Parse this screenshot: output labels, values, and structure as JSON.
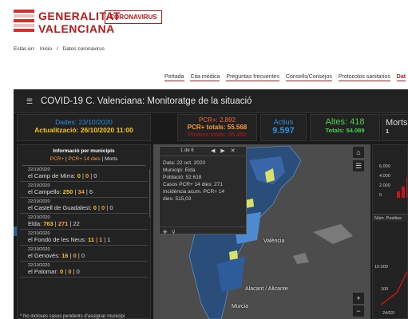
{
  "header": {
    "logo_line1": "GENERALITAT",
    "logo_line2": "VALENCIANA",
    "corona_label": "CORONAVIRUS"
  },
  "breadcrumb": {
    "prefix": "Estàs en:",
    "home": "Inicio",
    "separator": "/",
    "current": "Datos coronavirus"
  },
  "topnav": {
    "items": [
      "Portada",
      "Cita médica",
      "Preguntas frecuentes",
      "Consells/Consejos",
      "Protocolos sanitarios",
      "Dat"
    ]
  },
  "dashboard": {
    "title": "COVID-19 C. Valenciana: Monitoratge de la situació",
    "dates": {
      "line1": "Dades: 23/10/2020",
      "line2": "Actualització: 26/10/2020 11:00"
    },
    "pcr": {
      "line1": "PCR+: 2.892",
      "line2": "PCR+ totals: 55.568",
      "line3": "Positius totals: 65.450"
    },
    "actius": {
      "label": "Actius",
      "value": "9.597"
    },
    "altes": {
      "label": "Altes: 418",
      "total": "Totals: 54.089"
    },
    "morts": {
      "label": "Morts:",
      "value": "1"
    }
  },
  "list": {
    "title": "Informació per municipis",
    "legend_pcr": "PCR+",
    "legend_pcr14": "PCR+ 14 dies",
    "legend_morts": "Morts",
    "items": [
      {
        "date": "22/10/2020",
        "name": "el Camp de Mirra:",
        "a": "0",
        "b": "0",
        "c": "0"
      },
      {
        "date": "22/10/2020",
        "name": "el Campello:",
        "a": "250",
        "b": "34",
        "c": "6"
      },
      {
        "date": "22/10/2020",
        "name": "el Castell de Guadalest:",
        "a": "0",
        "b": "0",
        "c": "0"
      },
      {
        "date": "22/10/2020",
        "name": "Elda:",
        "a": "763",
        "b": "271",
        "c": "22"
      },
      {
        "date": "22/10/2020",
        "name": "el Fondó de les Neus:",
        "a": "11",
        "b": "1",
        "c": "1"
      },
      {
        "date": "22/10/2020",
        "name": "el Genovés:",
        "a": "16",
        "b": "0",
        "c": "0"
      },
      {
        "date": "22/10/2020",
        "name": "el Palomar:",
        "a": "0",
        "b": "0",
        "c": "0"
      }
    ],
    "footer": "* No incloses casos pendents d'assignar municipi"
  },
  "popup": {
    "count": "1 de 6",
    "lines": [
      "Data: 22 oct. 2020",
      "Municipi: Elda",
      "Població: 52.618",
      "Casos PCR+ 14 dies: 271",
      "Incidència acum. PCR+ 14",
      "dies: 515,03"
    ]
  },
  "map": {
    "labels": {
      "valencia": "València",
      "alacant": "Alacant / Alicante",
      "murcia": "Murcia"
    }
  },
  "right_panel": {
    "axis1": [
      "6.000",
      "4.000",
      "2.000",
      "0"
    ],
    "tab": "Núm. Positius",
    "axis2": [
      "10.000",
      "100"
    ],
    "date": "24/02/"
  }
}
